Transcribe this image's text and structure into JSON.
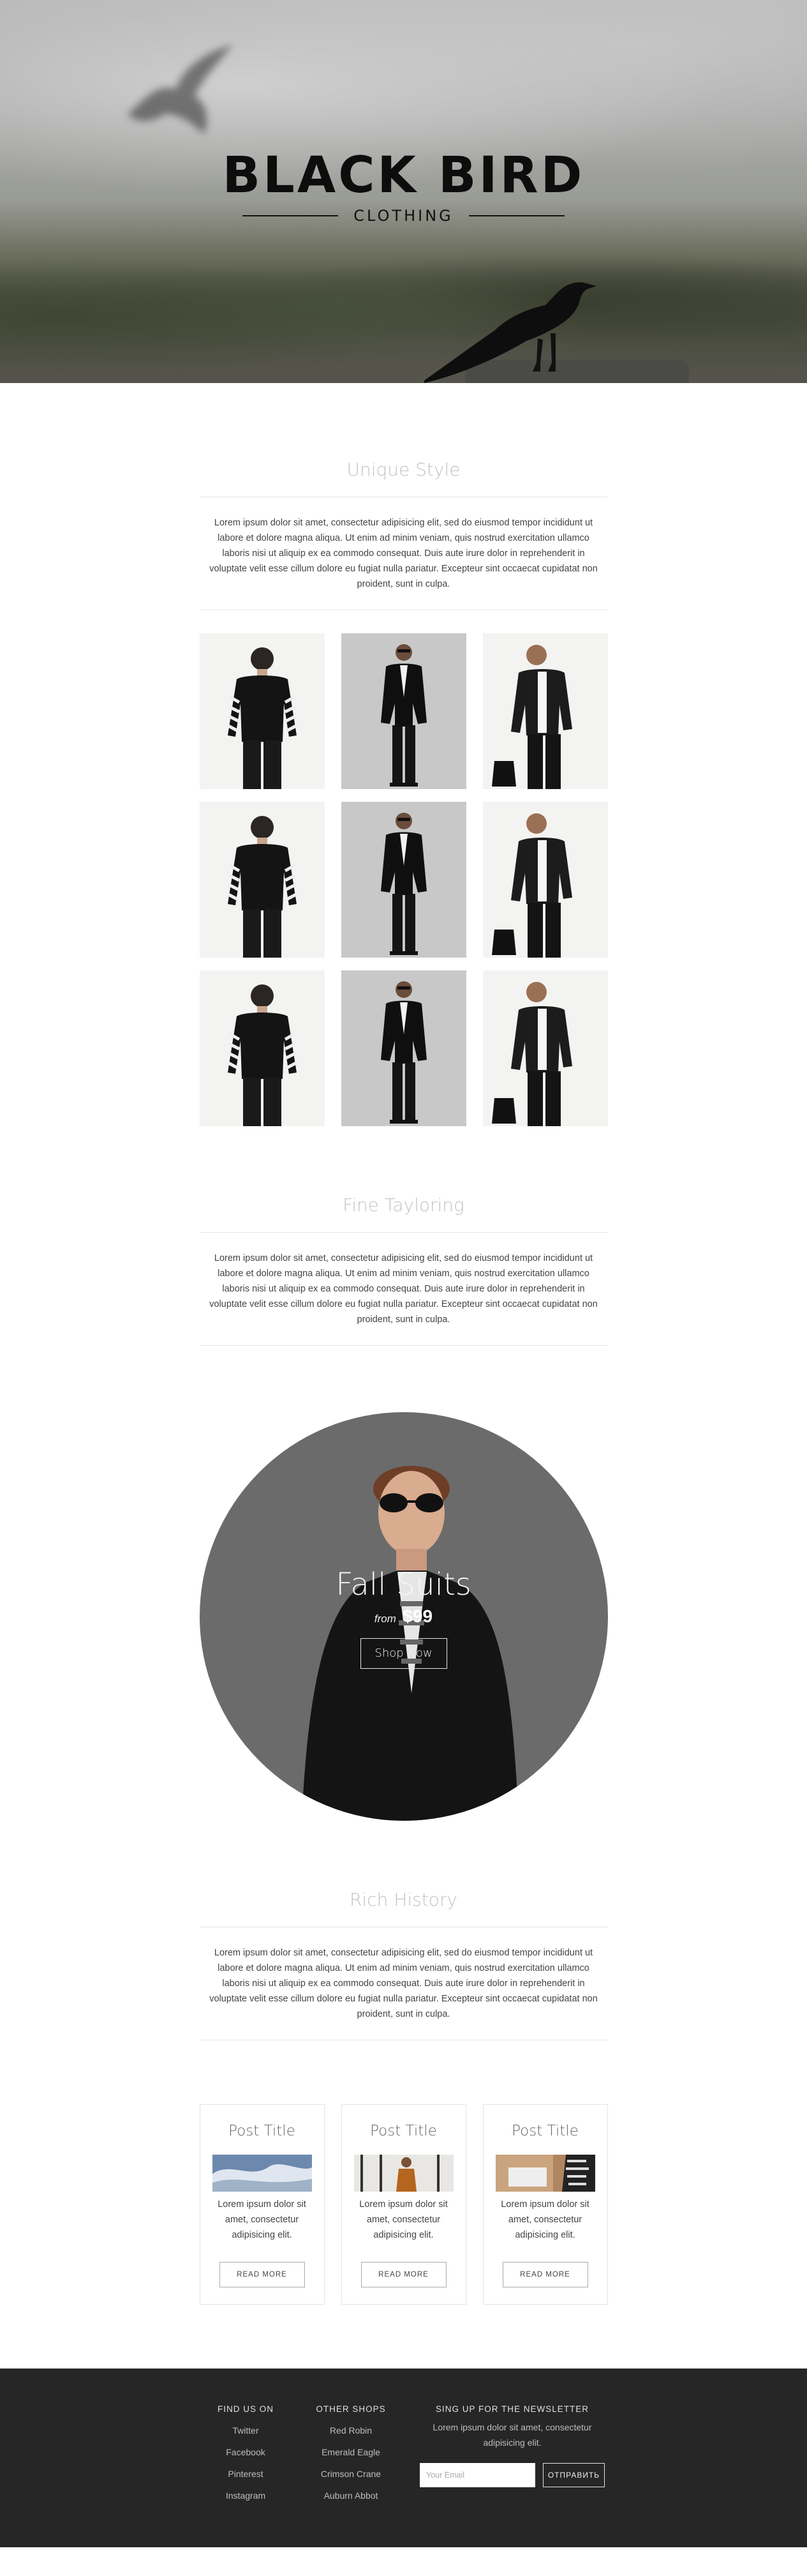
{
  "hero": {
    "title": "BLACK BIRD",
    "subtitle": "CLOTHING"
  },
  "unique": {
    "title": "Unique Style",
    "text": "Lorem ipsum dolor sit amet, consectetur adipisicing elit, sed do eiusmod tempor incididunt ut labore et dolore magna aliqua. Ut enim ad minim veniam, quis nostrud exercitation ullamco laboris nisi ut aliquip ex ea commodo consequat. Duis aute irure dolor in reprehenderit in voluptate velit esse cillum dolore eu fugiat nulla pariatur. Excepteur sint occaecat cupidatat non proident, sunt in culpa."
  },
  "tailoring": {
    "title": "Fine Tayloring",
    "text": "Lorem ipsum dolor sit amet, consectetur adipisicing elit, sed do eiusmod tempor incididunt ut labore et dolore magna aliqua. Ut enim ad minim veniam, quis nostrud exercitation ullamco laboris nisi ut aliquip ex ea commodo consequat. Duis aute irure dolor in reprehenderit in voluptate velit esse cillum dolore eu fugiat nulla pariatur. Excepteur sint occaecat cupidatat non proident, sunt in culpa."
  },
  "promo": {
    "title": "Fall Suits",
    "from": "from",
    "price": "$99",
    "button": "Shop Now"
  },
  "history": {
    "title": "Rich History",
    "text": "Lorem ipsum dolor sit amet, consectetur adipisicing elit, sed do eiusmod tempor incididunt ut labore et dolore magna aliqua. Ut enim ad minim veniam, quis nostrud exercitation ullamco laboris nisi ut aliquip ex ea commodo consequat. Duis aute irure dolor in reprehenderit in voluptate velit esse cillum dolore eu fugiat nulla pariatur. Excepteur sint occaecat cupidatat non proident, sunt in culpa."
  },
  "posts": [
    {
      "title": "Post Title",
      "text": "Lorem ipsum dolor sit amet, consectetur adipisicing elit.",
      "button": "READ MORE"
    },
    {
      "title": "Post Title",
      "text": "Lorem ipsum dolor sit amet, consectetur adipisicing elit.",
      "button": "READ MORE"
    },
    {
      "title": "Post Title",
      "text": "Lorem ipsum dolor sit amet, consectetur adipisicing elit.",
      "button": "READ MORE"
    }
  ],
  "footer": {
    "find_us": {
      "heading": "FIND US ON",
      "links": [
        "Twitter",
        "Facebook",
        "Pinterest",
        "Instagram"
      ]
    },
    "other_shops": {
      "heading": "OTHER SHOPS",
      "links": [
        "Red Robin",
        "Emerald Eagle",
        "Crimson Crane",
        "Auburn Abbot"
      ]
    },
    "newsletter": {
      "heading": "SING UP FOR THE NEWSLETTER",
      "text": "Lorem ipsum dolor sit amet, consectetur adipisicing elit.",
      "placeholder": "Your Email",
      "button": "ОТПРАВИТЬ"
    }
  },
  "colors": {
    "footer_bg": "#262626",
    "promo_circle": "#6b6b6b",
    "section_title": "#c2c2c2"
  }
}
